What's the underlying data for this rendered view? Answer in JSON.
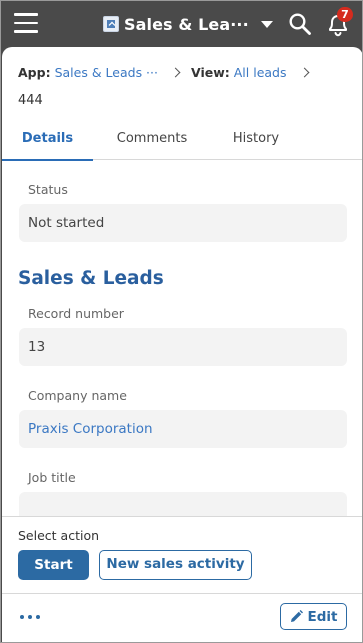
{
  "header": {
    "app_title": "Sales & Lea···",
    "notification_count": "7",
    "icons": {
      "menu": "hamburger-menu-icon",
      "app": "app-icon",
      "dropdown": "chevron-down-icon",
      "search": "search-icon",
      "notifications": "bell-icon"
    }
  },
  "breadcrumb": {
    "app_label": "App:",
    "app_link": "Sales & Leads ···",
    "view_label": "View:",
    "view_link": "All leads"
  },
  "record_id": "444",
  "tabs": [
    {
      "label": "Details",
      "active": true
    },
    {
      "label": "Comments",
      "active": false
    },
    {
      "label": "History",
      "active": false
    }
  ],
  "fields": {
    "status": {
      "label": "Status",
      "value": "Not started"
    },
    "section_title": "Sales & Leads",
    "record_number": {
      "label": "Record number",
      "value": "13"
    },
    "company_name": {
      "label": "Company name",
      "value": "Praxis Corporation"
    },
    "job_title": {
      "label": "Job title",
      "value": ""
    }
  },
  "actions": {
    "select_label": "Select action",
    "start_label": "Start",
    "new_activity_label": "New sales activity",
    "edit_label": "Edit"
  },
  "colors": {
    "header_bg": "#4a4a4a",
    "accent": "#2c6aa3",
    "link": "#3b78c3",
    "badge": "#d52b1e"
  }
}
